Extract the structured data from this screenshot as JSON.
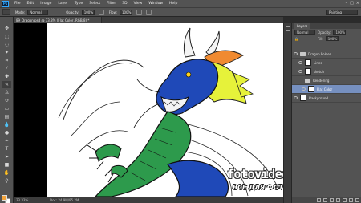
{
  "app": {
    "logo": "Ps"
  },
  "menu": [
    "File",
    "Edit",
    "Image",
    "Layer",
    "Type",
    "Select",
    "Filter",
    "3D",
    "View",
    "Window",
    "Help"
  ],
  "options": {
    "mode_label": "Mode:",
    "mode_value": "Normal",
    "opacity_label": "Opacity:",
    "opacity_value": "100%",
    "flow_label": "Flow:",
    "flow_value": "100%",
    "workspace": "Painting"
  },
  "document": {
    "tab_title": "89_Dragon.psd @ 33.3% (Flat Color, RGB/8) *",
    "zoom": "33.33%",
    "doc_info": "Doc: 24.9M/95.2M"
  },
  "layers_panel": {
    "title": "Layers",
    "blend_mode": "Normal",
    "opacity_label": "Opacity:",
    "opacity_value": "100%",
    "fill_label": "Fill:",
    "fill_value": "100%",
    "items": [
      {
        "name": "Dragon Folder",
        "kind": "folder",
        "visible": true
      },
      {
        "name": "Lines",
        "kind": "layer",
        "visible": true
      },
      {
        "name": "sketch",
        "kind": "layer",
        "visible": true
      },
      {
        "name": "Rendering",
        "kind": "folder",
        "visible": false
      },
      {
        "name": "Flat Color",
        "kind": "layer",
        "visible": true,
        "selected": true
      },
      {
        "name": "Background",
        "kind": "layer",
        "visible": true
      }
    ]
  },
  "colors": {
    "foreground": "#f2a33a",
    "background": "#ffffff",
    "dragon_blue": "#1f49b8",
    "dragon_green": "#2d9a4c",
    "dragon_yellow": "#e6f23a",
    "dragon_orange": "#f08a30"
  },
  "watermark": {
    "line1": "fotovideoeffect.com",
    "line2": "ВСЕ ДЛЯ ФОТО И ВИДЕО МОНТАЖА!"
  }
}
